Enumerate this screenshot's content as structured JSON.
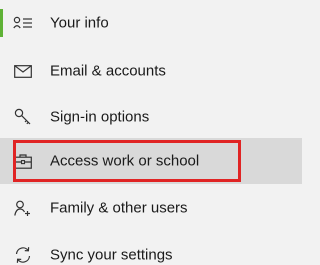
{
  "nav": {
    "items": [
      {
        "label": "Your info",
        "icon": "person-lines-icon",
        "active": true
      },
      {
        "label": "Email & accounts",
        "icon": "envelope-icon"
      },
      {
        "label": "Sign-in options",
        "icon": "key-icon"
      },
      {
        "label": "Access work or school",
        "icon": "briefcase-icon",
        "selected": true
      },
      {
        "label": "Family & other users",
        "icon": "add-person-icon"
      },
      {
        "label": "Sync your settings",
        "icon": "sync-icon"
      }
    ]
  },
  "colors": {
    "background": "#f2f2f2",
    "selected_background": "#d9d9d9",
    "active_indicator": "#5fb236",
    "highlight_border": "#e02424",
    "text": "#1a1a1a"
  }
}
